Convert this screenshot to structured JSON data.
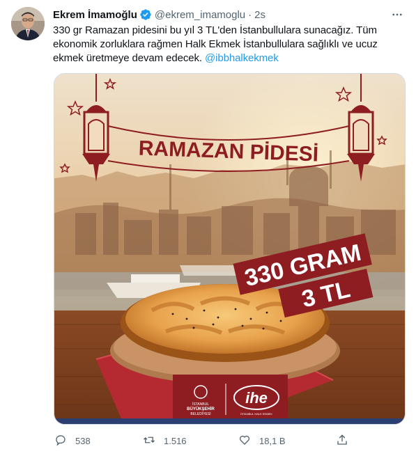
{
  "tweet": {
    "author_name": "Ekrem İmamoğlu",
    "handle": "@ekrem_imamoglu",
    "separator": "·",
    "time": "2s",
    "text_lines": [
      "330 gr Ramazan pidesini bu yıl 3 TL'den İstanbullulara sunacağız. Tüm",
      "ekonomik zorluklara rağmen Halk Ekmek İstanbullulara sağlıklı ve ucuz",
      "ekmek üretmeye devam edecek. "
    ],
    "hashtag": "@ibbhalkekmek"
  },
  "media": {
    "banner_text": "RAMAZAN PİDESİ",
    "weight_text": "330 GRAM",
    "price_text": "3 TL",
    "logo_left_lines": [
      "İSTANBUL",
      "BÜYÜKŞEHİR",
      "BELEDİYESİ"
    ],
    "logo_right_text": "ihe",
    "logo_right_sub": "İSTANBUL HALK EKMEK"
  },
  "actions": {
    "reply_count": "538",
    "retweet_count": "1.516",
    "like_count": "18,1 B",
    "share_label": ""
  },
  "icons": {
    "verified": "verified-badge-icon",
    "more": "more-options-icon",
    "reply": "reply-icon",
    "retweet": "retweet-icon",
    "like": "like-icon",
    "share": "share-icon"
  },
  "colors": {
    "brand_blue": "#1d9bf0",
    "text_primary": "#0f1419",
    "text_secondary": "#536471",
    "poster_red": "#8e1d22"
  }
}
